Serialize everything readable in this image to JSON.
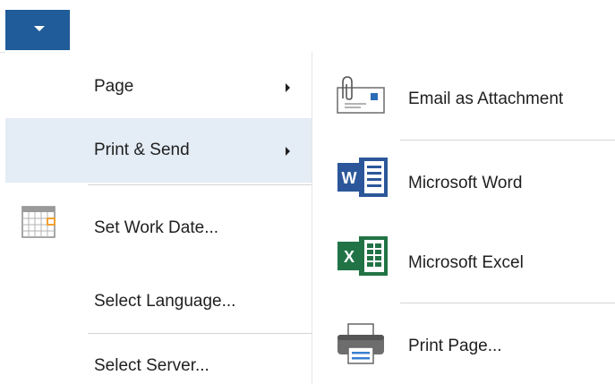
{
  "colors": {
    "accent": "#1f5c99",
    "selected_bg": "#e4ecf5",
    "word_blue": "#2b579a",
    "excel_green": "#217346"
  },
  "toolbar": {
    "app_menu_icon": "chevron-down-icon"
  },
  "menu": {
    "items": [
      {
        "label": "Page",
        "has_submenu": true
      },
      {
        "label": "Print & Send",
        "has_submenu": true,
        "selected": true
      },
      {
        "label": "Set Work Date...",
        "icon": "calendar-icon"
      },
      {
        "label": "Select Language..."
      },
      {
        "label": "Select Server..."
      }
    ]
  },
  "submenu": {
    "items": [
      {
        "label": "Email as Attachment",
        "icon": "email-attachment-icon"
      },
      {
        "label": "Microsoft Word",
        "icon": "word-icon",
        "icon_letter": "W"
      },
      {
        "label": "Microsoft Excel",
        "icon": "excel-icon",
        "icon_letter": "X"
      },
      {
        "label": "Print Page...",
        "icon": "printer-icon"
      }
    ]
  }
}
